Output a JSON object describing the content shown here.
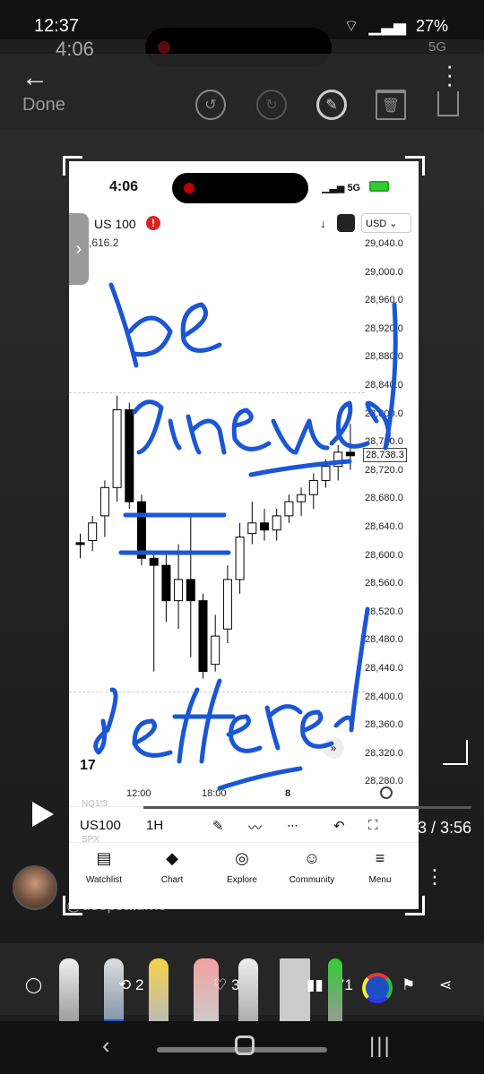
{
  "status_bar": {
    "time": "12:37",
    "battery": "27%",
    "ghost_time": "4:06",
    "ghost_network": "5G"
  },
  "editor": {
    "done_label": "Done",
    "icons": [
      "back-arrow-icon",
      "undo-icon",
      "redo-icon",
      "pen-icon",
      "trash-icon",
      "share-icon",
      "more-icon"
    ]
  },
  "screenshot": {
    "time": "4:06",
    "network": "5G",
    "symbol": "US 100",
    "last_price": ",616.2",
    "currency": "USD",
    "current_price_tag": "28,738.3",
    "price_ticks": [
      "29,040.0",
      "29,000.0",
      "28,960.0",
      "28,920.0",
      "28,880.0",
      "28,840.0",
      "28,800.0",
      "28,760.0",
      "28,720.0",
      "28,680.0",
      "28,640.0",
      "28,600.0",
      "28,560.0",
      "28,520.0",
      "28,480.0",
      "28,440.0",
      "28,400.0",
      "28,360.0",
      "28,320.0",
      "28,280.0"
    ],
    "time_ticks": [
      "12:00",
      "18:00",
      "8"
    ],
    "toolbar": {
      "symbol": "US100",
      "interval": "1H",
      "ghost_top": "NQ1!3",
      "ghost_bottom": "SPX"
    },
    "nav": [
      {
        "label": "Watchlist",
        "icon": "watchlist-icon"
      },
      {
        "label": "Chart",
        "icon": "chart-icon"
      },
      {
        "label": "Explore",
        "icon": "compass-icon"
      },
      {
        "label": "Community",
        "icon": "community-icon"
      },
      {
        "label": "Menu",
        "icon": "menu-icon"
      }
    ]
  },
  "annotations": {
    "handwriting": [
      "be",
      "cinceled",
      "deffered"
    ],
    "ink_color": "#1a56d6"
  },
  "video": {
    "duration": "3 / 3:56",
    "username": "@deepsaturno",
    "retweets": "2",
    "likes": "3",
    "views": "171"
  },
  "colors": {
    "background": "#1f1f1f",
    "ink": "#1a56d6",
    "candle_up": "#ffffff",
    "candle_down": "#000000"
  },
  "chart_data": {
    "type": "candlestick",
    "ylim": [
      28280,
      29040
    ],
    "candles_ohlc": [
      [
        28612,
        28625,
        28590,
        28610
      ],
      [
        28615,
        28650,
        28600,
        28640
      ],
      [
        28650,
        28700,
        28620,
        28690
      ],
      [
        28690,
        28820,
        28670,
        28800
      ],
      [
        28800,
        28810,
        28660,
        28670
      ],
      [
        28670,
        28680,
        28580,
        28590
      ],
      [
        28590,
        28600,
        28430,
        28580
      ],
      [
        28580,
        28600,
        28500,
        28530
      ],
      [
        28530,
        28610,
        28490,
        28560
      ],
      [
        28560,
        28650,
        28450,
        28530
      ],
      [
        28530,
        28540,
        28420,
        28430
      ],
      [
        28440,
        28510,
        28430,
        28480
      ],
      [
        28490,
        28580,
        28470,
        28560
      ],
      [
        28560,
        28640,
        28540,
        28620
      ],
      [
        28625,
        28670,
        28610,
        28640
      ],
      [
        28640,
        28660,
        28615,
        28630
      ],
      [
        28630,
        28660,
        28615,
        28650
      ],
      [
        28650,
        28680,
        28640,
        28670
      ],
      [
        28670,
        28690,
        28650,
        28680
      ],
      [
        28680,
        28710,
        28660,
        28700
      ],
      [
        28700,
        28730,
        28690,
        28720
      ],
      [
        28720,
        28750,
        28700,
        28740
      ],
      [
        28740,
        28780,
        28715,
        28735
      ]
    ]
  }
}
